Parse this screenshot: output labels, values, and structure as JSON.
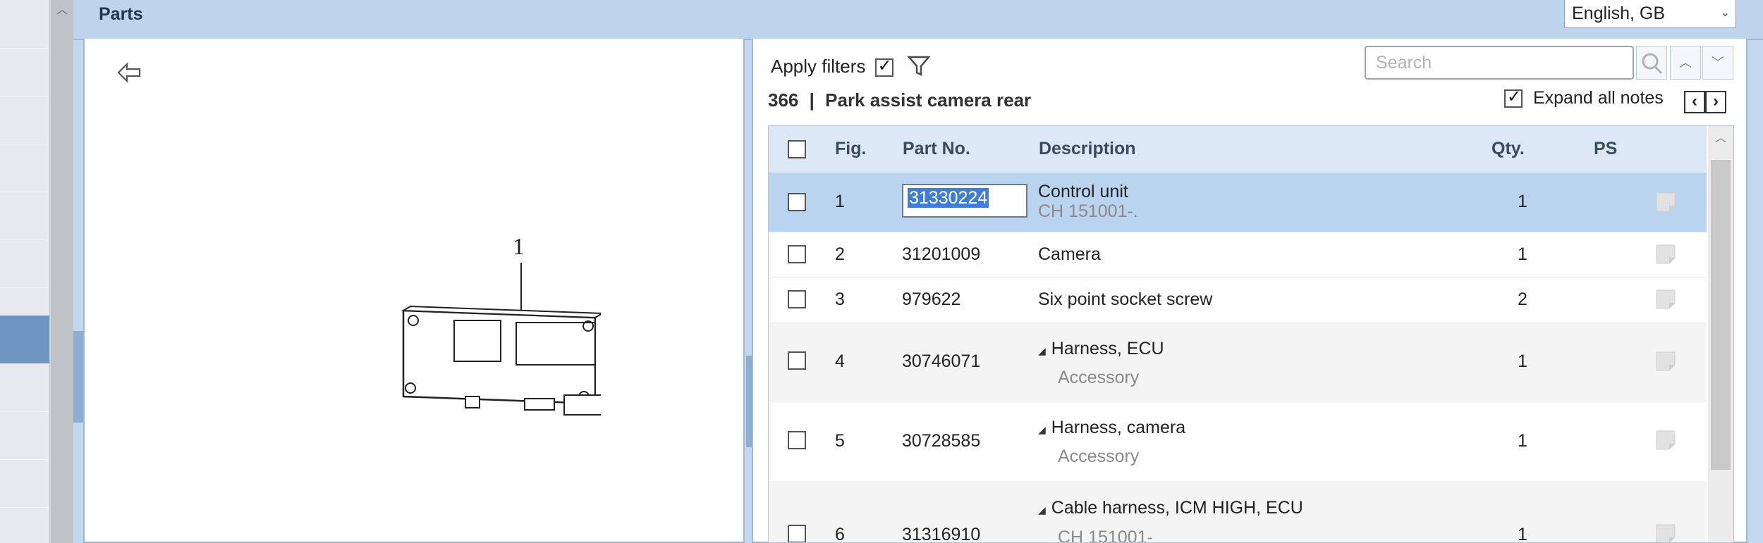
{
  "panel": {
    "title": "Parts"
  },
  "language": {
    "selected": "English, GB"
  },
  "toolbar": {
    "apply_filters_label": "Apply filters",
    "apply_filters_checked": true,
    "search_placeholder": "Search",
    "expand_notes_label": "Expand all notes",
    "expand_notes_checked": true
  },
  "section": {
    "number": "366",
    "separator": "|",
    "title": "Park assist camera rear"
  },
  "illustration": {
    "callout": "1"
  },
  "table": {
    "headers": {
      "fig": "Fig.",
      "partno": "Part No.",
      "description": "Description",
      "qty": "Qty.",
      "ps": "PS"
    },
    "rows": [
      {
        "fig": "1",
        "partno": "31330224",
        "description": "Control unit",
        "note": "CH 151001-.",
        "qty": "1",
        "selected": true,
        "expandable": false
      },
      {
        "fig": "2",
        "partno": "31201009",
        "description": "Camera",
        "note": "",
        "qty": "1",
        "selected": false,
        "expandable": false
      },
      {
        "fig": "3",
        "partno": "979622",
        "description": "Six point socket screw",
        "note": "",
        "qty": "2",
        "selected": false,
        "expandable": false
      },
      {
        "fig": "4",
        "partno": "30746071",
        "description": "Harness, ECU",
        "note": "Accessory",
        "qty": "1",
        "selected": false,
        "expandable": true
      },
      {
        "fig": "5",
        "partno": "30728585",
        "description": "Harness, camera",
        "note": "Accessory",
        "qty": "1",
        "selected": false,
        "expandable": true
      },
      {
        "fig": "6",
        "partno": "31316910",
        "description": "Cable harness, ICM HIGH, ECU",
        "note": "CH 151001-",
        "qty": "1",
        "selected": false,
        "expandable": true
      }
    ]
  }
}
